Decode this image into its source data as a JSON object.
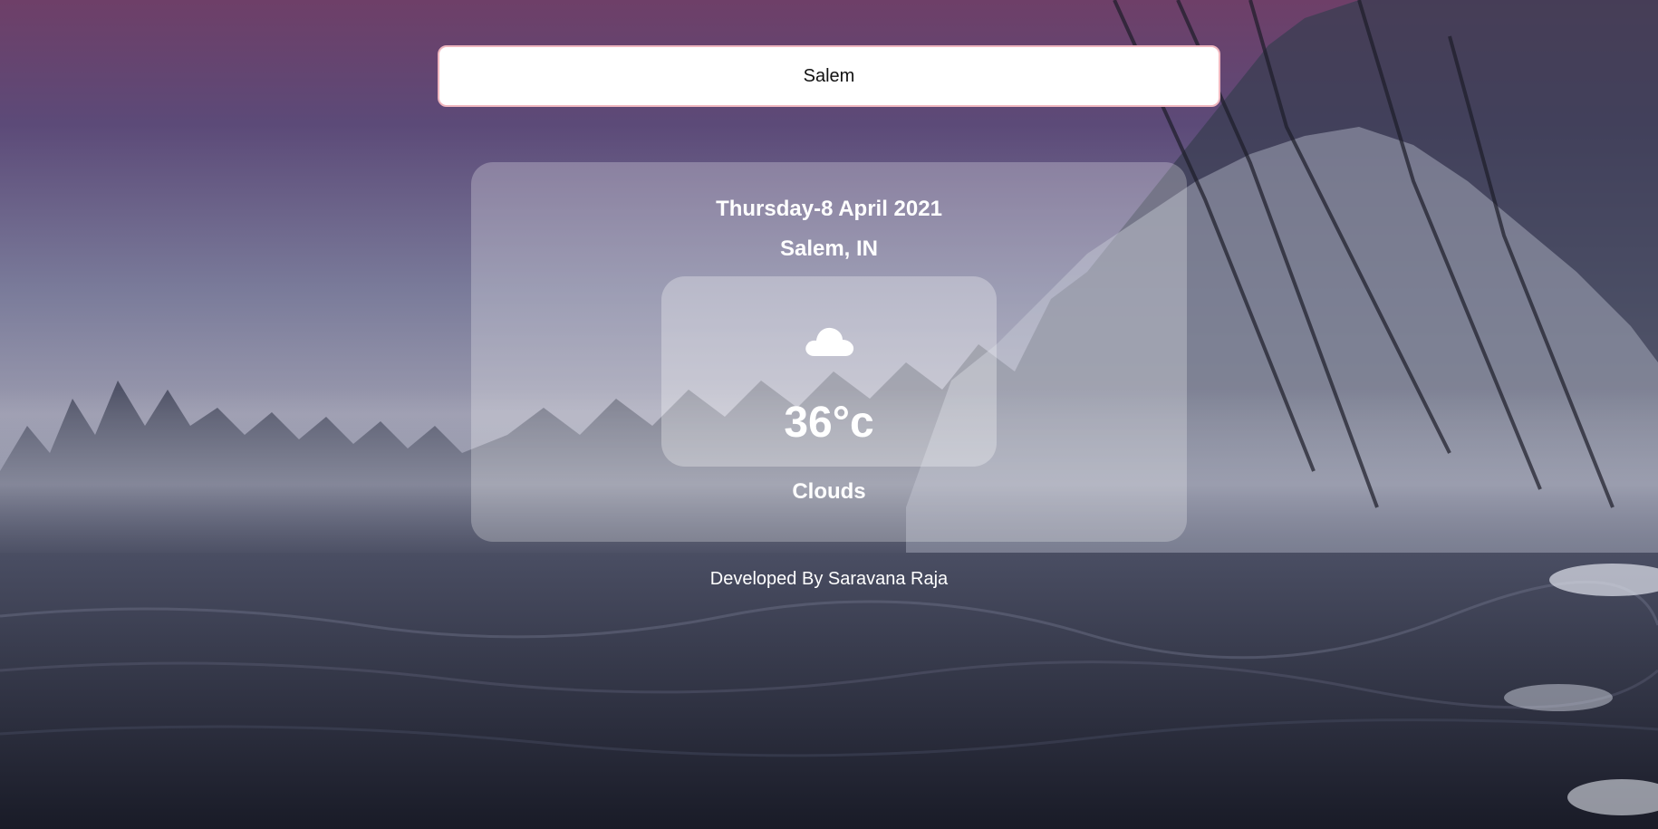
{
  "search": {
    "value": "Salem"
  },
  "weather": {
    "date": "Thursday-8 April 2021",
    "location": "Salem, IN",
    "icon": "cloud-icon",
    "temperature": "36°c",
    "condition": "Clouds"
  },
  "footer": {
    "credit": "Developed By Saravana Raja"
  }
}
